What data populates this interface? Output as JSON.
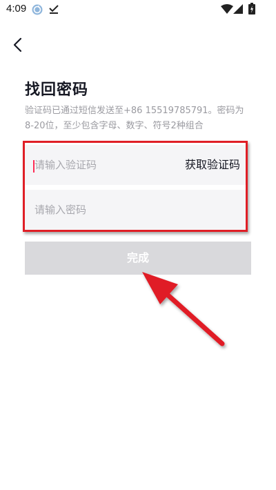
{
  "status_bar": {
    "time": "4:09"
  },
  "header": {
    "title": "找回密码",
    "hint": "验证码已通过短信发送至+86 15519785791。密码为8-20位，至少包含字母、数字、符号2种组合"
  },
  "form": {
    "code_placeholder": "请输入验证码",
    "get_code_label": "获取验证码",
    "password_placeholder": "请输入密码"
  },
  "actions": {
    "done_label": "完成"
  },
  "colors": {
    "accent": "#fe2c55",
    "annotation": "#e01e26",
    "button_disabled": "#d9d9dc"
  }
}
